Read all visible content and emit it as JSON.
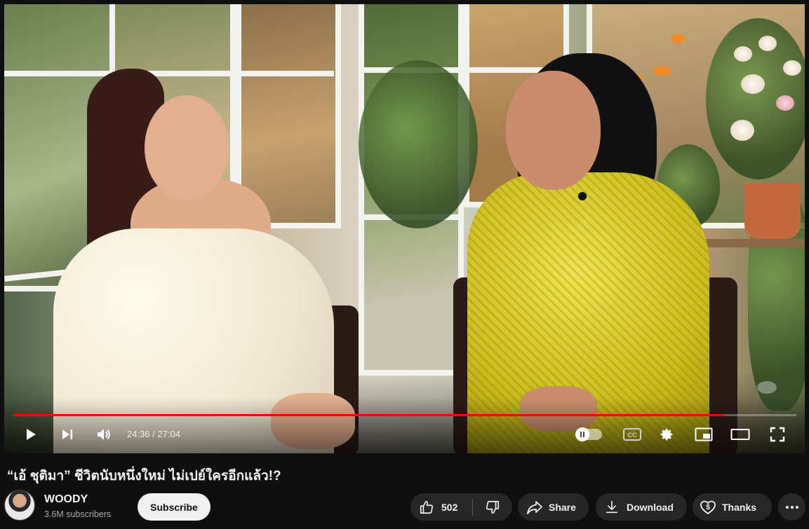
{
  "player": {
    "current_time": "24:36",
    "separator": "/",
    "duration": "27:04",
    "progress_fraction": 0.909,
    "progress_color": "#ff0000"
  },
  "video": {
    "title": "“เอ้ ชุติมา” ชีวิตนับหนึ่งใหม่ ไม่เปย์ใครอีกแล้ว!?"
  },
  "channel": {
    "name": "WOODY",
    "subscribers": "3.6M subscribers",
    "subscribe_label": "Subscribe"
  },
  "actions": {
    "like_count": "502",
    "share_label": "Share",
    "download_label": "Download",
    "thanks_label": "Thanks"
  },
  "icons": [
    "play-icon",
    "next-icon",
    "volume-icon",
    "autoplay-toggle",
    "cc-icon",
    "gear-icon",
    "miniplayer-icon",
    "theater-icon",
    "fullscreen-icon",
    "thumbs-up-icon",
    "thumbs-down-icon",
    "share-icon",
    "download-icon",
    "thanks-icon",
    "more-icon"
  ],
  "colors": {
    "background": "#0f0f0f",
    "pill": "#272727",
    "subscribe_bg": "#f1f1f1"
  }
}
